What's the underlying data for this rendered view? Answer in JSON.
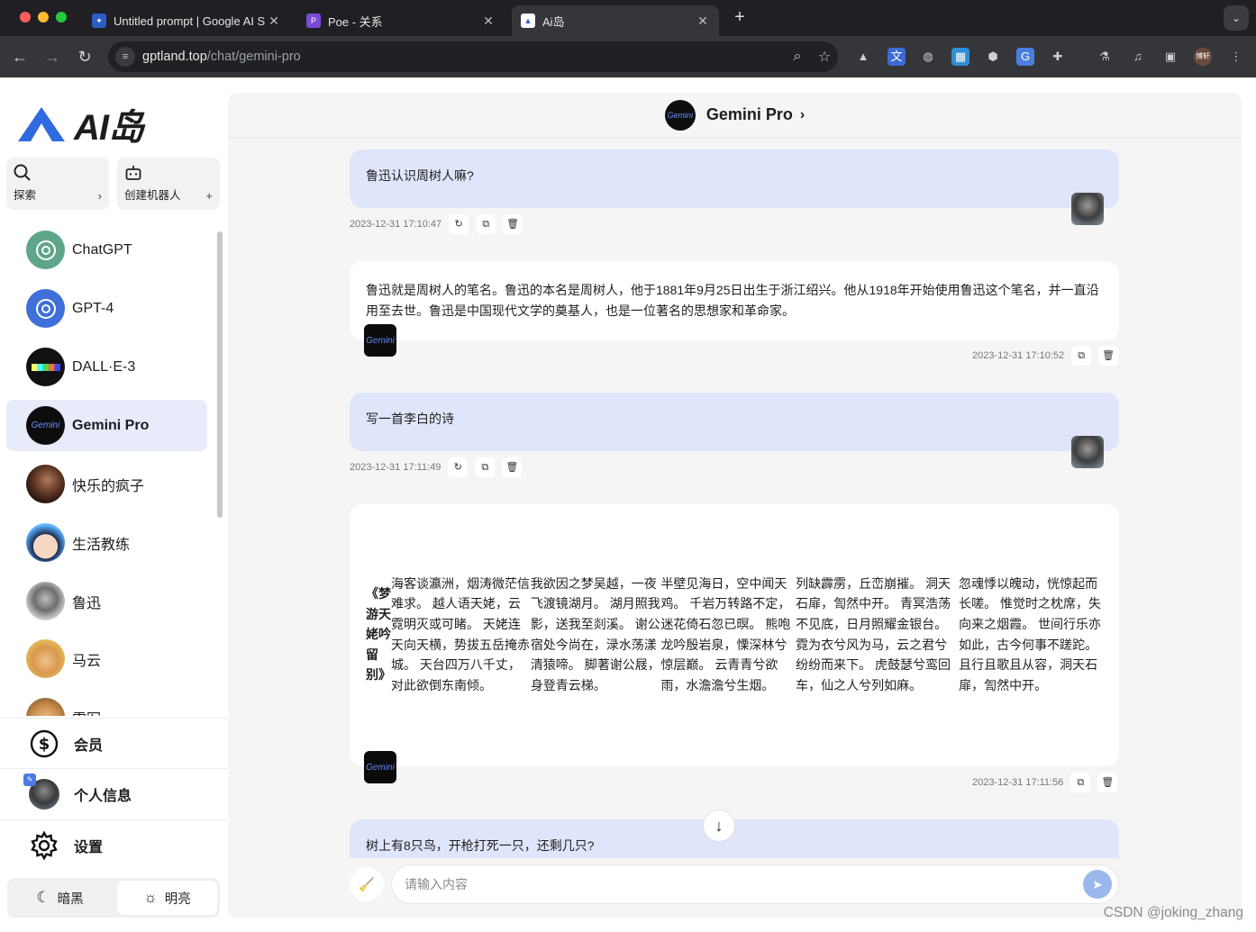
{
  "browser": {
    "tabs": [
      {
        "title": "Untitled prompt | Google AI S",
        "active": false
      },
      {
        "title": "Poe - 关系",
        "active": false
      },
      {
        "title": "Ai岛",
        "active": true
      }
    ],
    "url_host": "gptland.top",
    "url_path": "/chat/gemini-pro",
    "profile_label": "博轩"
  },
  "sidebar": {
    "logo_text": "AI岛",
    "explore_label": "探索",
    "create_bot_label": "创建机器人",
    "bots": [
      {
        "name": "ChatGPT"
      },
      {
        "name": "GPT-4"
      },
      {
        "name": "DALL·E-3"
      },
      {
        "name": "Gemini Pro"
      },
      {
        "name": "快乐的疯子"
      },
      {
        "name": "生活教练"
      },
      {
        "name": "鲁迅"
      },
      {
        "name": "马云"
      },
      {
        "name": "雷军"
      }
    ],
    "menu": {
      "member": "会员",
      "profile": "个人信息",
      "settings": "设置"
    },
    "theme": {
      "dark": "暗黑",
      "light": "明亮"
    }
  },
  "chat": {
    "bot_name": "Gemini Pro",
    "bot_avatar_text": "Gemini",
    "messages": [
      {
        "role": "user",
        "text": "鲁迅认识周树人嘛?",
        "time": "2023-12-31 17:10:47"
      },
      {
        "role": "bot",
        "text": "鲁迅就是周树人的笔名。鲁迅的本名是周树人，他于1881年9月25日出生于浙江绍兴。他从1918年开始使用鲁迅这个笔名，并一直沿用至去世。鲁迅是中国现代文学的奠基人，也是一位著名的思想家和革命家。",
        "time": "2023-12-31 17:10:52"
      },
      {
        "role": "user",
        "text": "写一首李白的诗",
        "time": "2023-12-31 17:11:49"
      },
      {
        "role": "bot",
        "title": "《梦游天姥吟留别》",
        "lines": [
          "海客谈瀛洲，烟涛微茫信难求。 越人语天姥，云霓明灭或可睹。 天姥连天向天横，势拔五岳掩赤城。 天台四万八千丈，对此欲倒东南倾。",
          "我欲因之梦吴越，一夜飞渡镜湖月。 湖月照我影，送我至剡溪。 谢公宿处今尚在，渌水荡漾清猿啼。 脚著谢公屐，身登青云梯。",
          "半壁见海日，空中闻天鸡。 千岩万转路不定，迷花倚石忽已暝。 熊咆龙吟殷岩泉，慄深林兮惊层巅。 云青青兮欲雨，水澹澹兮生烟。",
          "列缺霹雳，丘峦崩摧。 洞天石扉，訇然中开。 青冥浩荡不见底，日月照耀金银台。 霓为衣兮风为马，云之君兮纷纷而来下。 虎鼓瑟兮鸾回车，仙之人兮列如麻。",
          "忽魂悸以魄动，恍惊起而长嗟。 惟觉时之枕席，失向来之烟霞。 世间行乐亦如此，古今何事不蹉跎。 且行且歌且从容，洞天石扉，訇然中开。"
        ],
        "time": "2023-12-31 17:11:56"
      },
      {
        "role": "user",
        "text": "树上有8只鸟，开枪打死一只，还剩几只?"
      }
    ],
    "input_placeholder": "请输入内容"
  },
  "watermark": "CSDN @joking_zhang"
}
